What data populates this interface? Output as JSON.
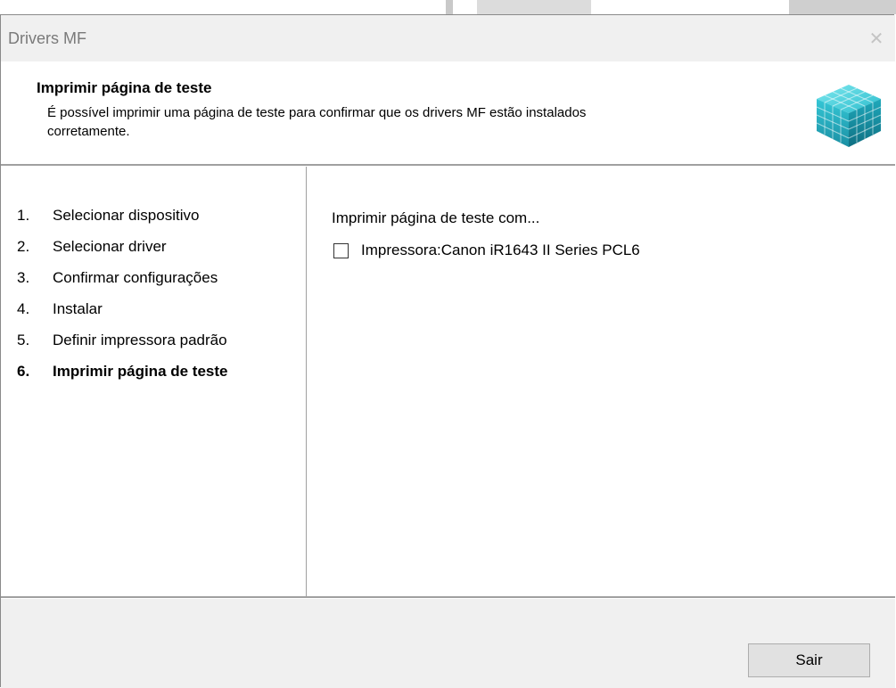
{
  "window": {
    "title": "Drivers MF",
    "close_glyph": "✕"
  },
  "header": {
    "title": "Imprimir página de teste",
    "description": "É possível imprimir uma página de teste para confirmar que os drivers MF estão instalados corretamente.",
    "icon": "canon-cube-icon"
  },
  "steps": [
    {
      "num": "1.",
      "label": "Selecionar dispositivo",
      "active": false
    },
    {
      "num": "2.",
      "label": "Selecionar driver",
      "active": false
    },
    {
      "num": "3.",
      "label": "Confirmar configurações",
      "active": false
    },
    {
      "num": "4.",
      "label": "Instalar",
      "active": false
    },
    {
      "num": "5.",
      "label": "Definir impressora padrão",
      "active": false
    },
    {
      "num": "6.",
      "label": "Imprimir página de teste",
      "active": true
    }
  ],
  "content": {
    "label": "Imprimir página de teste com...",
    "printer_option": {
      "label": "Impressora:Canon iR1643 II Series PCL6",
      "checked": false
    }
  },
  "footer": {
    "exit_label": "Sair"
  },
  "colors": {
    "accent_cube": "#22b7c9",
    "dialog_bg": "#f0f0f0"
  }
}
